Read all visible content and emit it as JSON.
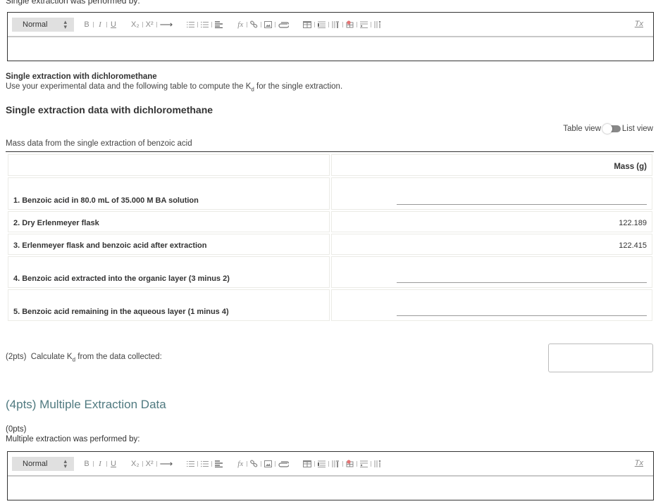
{
  "single_editor": {
    "label": "Single extraction was performed by:",
    "format_select": "Normal",
    "toolbar": {
      "bold": "B",
      "italic": "I",
      "underline": "U",
      "subscript": "X₂",
      "superscript": "X²",
      "arrow": "⟶",
      "formula": "fx",
      "clear_format": "Tx"
    },
    "content": ""
  },
  "single_section": {
    "title": "Single extraction with dichloromethane",
    "description_pre": "Use your experimental data and the following table to compute the K",
    "description_sub": "d",
    "description_post": " for the single extraction."
  },
  "data_section": {
    "title": "Single extraction data with dichloromethane",
    "view_toggle": {
      "left_label": "Table view",
      "right_label": "List view",
      "selected": "Table view"
    },
    "table_caption": "Mass data from the single extraction of benzoic acid",
    "columns": [
      "",
      "Mass (g)"
    ],
    "rows": [
      {
        "label": "1. Benzoic acid in 80.0 mL of 35.000 M BA solution",
        "value": "",
        "input": true
      },
      {
        "label": "2. Dry Erlenmeyer flask",
        "value": "122.189",
        "input": false
      },
      {
        "label": "3. Erlenmeyer flask and benzoic acid after extraction",
        "value": "122.415",
        "input": false
      },
      {
        "label": "4. Benzoic acid extracted into the organic layer (3 minus 2)",
        "value": "",
        "input": true
      },
      {
        "label": "5. Benzoic acid remaining in the aqueous layer (1 minus 4)",
        "value": "",
        "input": true
      }
    ]
  },
  "kd_question": {
    "points": "(2pts)",
    "text_pre": "Calculate K",
    "text_sub": "d",
    "text_post": " from the data collected:",
    "answer": ""
  },
  "multiple_section": {
    "title": "(4pts) Multiple Extraction Data",
    "points": "(0pts)",
    "label": "Multiple extraction was performed by:"
  },
  "multi_editor": {
    "format_select": "Normal",
    "toolbar": {
      "bold": "B",
      "italic": "I",
      "underline": "U",
      "subscript": "X₂",
      "superscript": "X²",
      "arrow": "⟶",
      "formula": "fx",
      "clear_format": "Tx"
    },
    "content": ""
  },
  "colors": {
    "section_heading": "#507a80",
    "table_border": "#ebebe6",
    "format_select_bg": "#e0e0e0"
  }
}
